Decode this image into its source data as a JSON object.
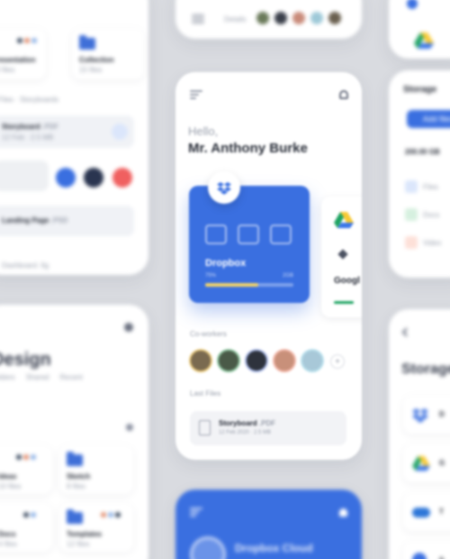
{
  "greeting": {
    "hello": "Hello,",
    "name": "Mr. Anthony Burke"
  },
  "dropbox_card": {
    "title": "Dropbox",
    "used": "75%",
    "total": "2GB",
    "progress": 0.6
  },
  "side_cards": {
    "drive_title": "Googl"
  },
  "co_workers": {
    "label": "Co-workers",
    "more": "+"
  },
  "last_files": {
    "label": "Last Files",
    "file_name": "Storyboard",
    "file_ext": ".PDF",
    "file_meta": "12 Feb 2020 · 2.5 MB"
  },
  "bottom_card": {
    "title": "Dropbox Cloud"
  },
  "left_panel": {
    "items": [
      {
        "title": "Presentation",
        "meta": "20 files"
      },
      {
        "title": "Collection",
        "meta": "15 files"
      }
    ],
    "recent_label": "Files",
    "recent_sub": "Storyboards",
    "file1": {
      "name": "Storyboard",
      "ext": ".PDF",
      "meta": "12 Feb · 2.5 MB"
    },
    "file2": {
      "name": "Landing Page",
      "ext": ".PSD",
      "meta": "10 Feb · 15 MB"
    },
    "footer": "Dashboard .fig"
  },
  "left_bottom": {
    "title": "Design",
    "tabs": [
      "Folders",
      "Shared",
      "Recent"
    ],
    "folders": [
      {
        "name": "Ideas",
        "meta": "10 files"
      },
      {
        "name": "Sketch",
        "meta": "8 files"
      },
      {
        "name": "Docs",
        "meta": "4 files"
      },
      {
        "name": "Templates",
        "meta": "12 files"
      }
    ]
  },
  "top_mid": {
    "label": "Details"
  },
  "right_panel": {
    "title": "Storage",
    "button": "Add files",
    "size": "200.00 GB",
    "list": [
      "Files",
      "Docs",
      "Video"
    ]
  },
  "right_bottom": {
    "title": "Storage",
    "items": [
      "D",
      "G",
      "T",
      "S"
    ]
  },
  "colors": {
    "accent": "#3a6fe0",
    "navy": "#2a3550",
    "coral": "#f06060",
    "bg": "#d9dbe0"
  }
}
